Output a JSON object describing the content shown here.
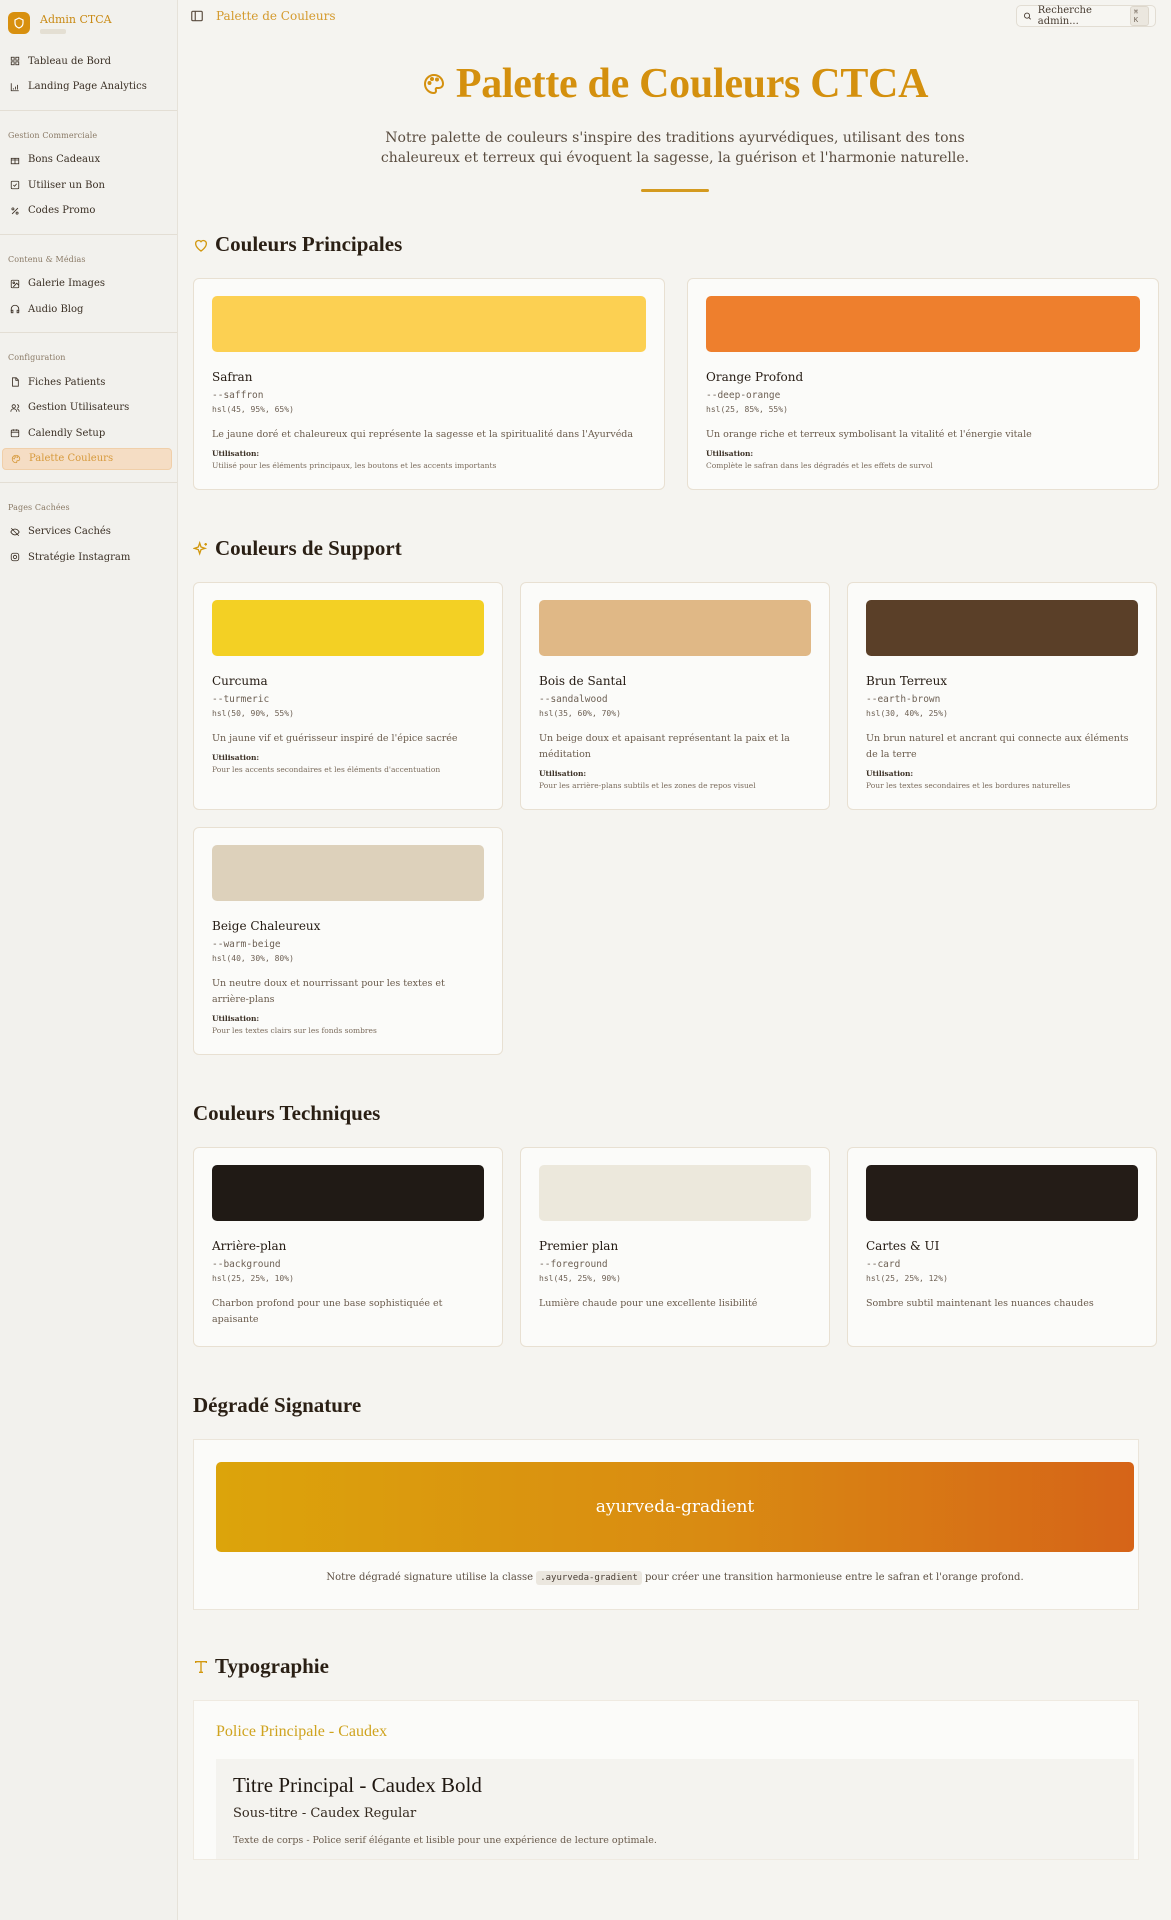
{
  "app": {
    "name": "Admin CTCA",
    "breadcrumb": "Palette de Couleurs",
    "search_placeholder": "Recherche admin...",
    "search_shortcut": "⌘ K"
  },
  "sidebar": {
    "top_items": [
      {
        "label": "Tableau de Bord",
        "icon": "grid-icon"
      },
      {
        "label": "Landing Page Analytics",
        "icon": "chart-icon"
      }
    ],
    "groups": [
      {
        "title": "Gestion Commerciale",
        "items": [
          {
            "label": "Bons Cadeaux",
            "icon": "gift-icon"
          },
          {
            "label": "Utiliser un Bon",
            "icon": "check-square-icon"
          },
          {
            "label": "Codes Promo",
            "icon": "percent-icon"
          }
        ]
      },
      {
        "title": "Contenu & Médias",
        "items": [
          {
            "label": "Galerie Images",
            "icon": "image-icon"
          },
          {
            "label": "Audio Blog",
            "icon": "headphones-icon"
          }
        ]
      },
      {
        "title": "Configuration",
        "items": [
          {
            "label": "Fiches Patients",
            "icon": "file-icon"
          },
          {
            "label": "Gestion Utilisateurs",
            "icon": "users-icon"
          },
          {
            "label": "Calendly Setup",
            "icon": "calendar-icon"
          },
          {
            "label": "Palette Couleurs",
            "icon": "palette-icon",
            "active": true
          }
        ]
      },
      {
        "title": "Pages Cachées",
        "items": [
          {
            "label": "Services Cachés",
            "icon": "eye-off-icon"
          },
          {
            "label": "Stratégie Instagram",
            "icon": "instagram-icon"
          }
        ]
      }
    ]
  },
  "hero": {
    "title": "Palette de Couleurs CTCA",
    "description": "Notre palette de couleurs s'inspire des traditions ayurvédiques, utilisant des tons chaleureux et terreux qui évoquent la sagesse, la guérison et l'harmonie naturelle."
  },
  "usage_label": "Utilisation:",
  "sections": {
    "principal": {
      "title": "Couleurs Principales",
      "colors": [
        {
          "name": "Safran",
          "var": "--saffron",
          "hsl": "hsl(45, 95%, 65%)",
          "swatch": "#fcd052",
          "description": "Le jaune doré et chaleureux qui représente la sagesse et la spiritualité dans l'Ayurvéda",
          "usage": "Utilisé pour les éléments principaux, les boutons et les accents importants"
        },
        {
          "name": "Orange Profond",
          "var": "--deep-orange",
          "hsl": "hsl(25, 85%, 55%)",
          "swatch": "#ee7f2d",
          "description": "Un orange riche et terreux symbolisant la vitalité et l'énergie vitale",
          "usage": "Complète le safran dans les dégradés et les effets de survol"
        }
      ]
    },
    "support": {
      "title": "Couleurs de Support",
      "colors": [
        {
          "name": "Curcuma",
          "var": "--turmeric",
          "hsl": "hsl(50, 90%, 55%)",
          "swatch": "#f3d024",
          "description": "Un jaune vif et guérisseur inspiré de l'épice sacrée",
          "usage": "Pour les accents secondaires et les éléments d'accentuation"
        },
        {
          "name": "Bois de Santal",
          "var": "--sandalwood",
          "hsl": "hsl(35, 60%, 70%)",
          "swatch": "#e0b886",
          "description": "Un beige doux et apaisant représentant la paix et la méditation",
          "usage": "Pour les arrière-plans subtils et les zones de repos visuel"
        },
        {
          "name": "Brun Terreux",
          "var": "--earth-brown",
          "hsl": "hsl(30, 40%, 25%)",
          "swatch": "#5a3f28",
          "description": "Un brun naturel et ancrant qui connecte aux éléments de la terre",
          "usage": "Pour les textes secondaires et les bordures naturelles"
        },
        {
          "name": "Beige Chaleureux",
          "var": "--warm-beige",
          "hsl": "hsl(40, 30%, 80%)",
          "swatch": "#ddd1bb",
          "description": "Un neutre doux et nourrissant pour les textes et arrière-plans",
          "usage": "Pour les textes clairs sur les fonds sombres"
        }
      ]
    },
    "technical": {
      "title": "Couleurs Techniques",
      "colors": [
        {
          "name": "Arrière-plan",
          "var": "--background",
          "hsl": "hsl(25, 25%, 10%)",
          "swatch": "#201a15",
          "description": "Charbon profond pour une base sophistiquée et apaisante"
        },
        {
          "name": "Premier plan",
          "var": "--foreground",
          "hsl": "hsl(45, 25%, 90%)",
          "swatch": "#ece8dc",
          "description": "Lumière chaude pour une excellente lisibilité"
        },
        {
          "name": "Cartes & UI",
          "var": "--card",
          "hsl": "hsl(25, 25%, 12%)",
          "swatch": "#241c17",
          "description": "Sombre subtil maintenant les nuances chaudes"
        }
      ]
    },
    "gradient": {
      "title": "Dégradé Signature",
      "label": "ayurveda-gradient",
      "note_before": "Notre dégradé signature utilise la classe",
      "note_code": ".ayurveda-gradient",
      "note_after": "pour créer une transition harmonieuse entre le safran et l'orange profond."
    },
    "typography": {
      "title": "Typographie",
      "font_label": "Police Principale - Caudex",
      "h1": "Titre Principal - Caudex Bold",
      "h2": "Sous-titre - Caudex Regular",
      "body": "Texte de corps - Police serif élégante et lisible pour une expérience de lecture optimale."
    }
  }
}
